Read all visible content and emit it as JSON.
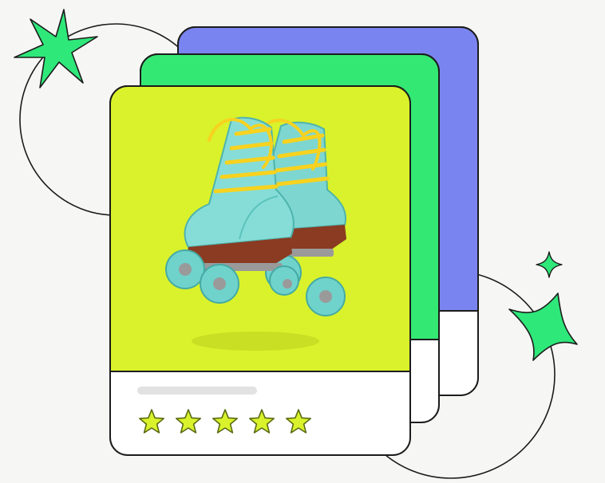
{
  "colors": {
    "background": "#f6f6f4",
    "card_back": "#7a84f0",
    "card_middle": "#34e874",
    "card_front_image": "#d9f22b",
    "card_footer": "#ffffff",
    "outline": "#1c1c1c",
    "sparkle": "#2ee87a",
    "star_fill": "#d9f22b",
    "placeholder_bar": "#e2e2e2",
    "skate_boot": "#7ed6d0",
    "skate_laces": "#f7d21e",
    "skate_sole": "#8a3b22",
    "skate_wheel": "#6fd3cc",
    "skate_plate": "#9a9a9a"
  },
  "product_card": {
    "image_icon": "roller-skates-icon",
    "rating": {
      "value": 5,
      "max": 5,
      "star_icon": "star-icon"
    }
  },
  "decorations": {
    "sparkle_icon": "sparkle-icon"
  }
}
